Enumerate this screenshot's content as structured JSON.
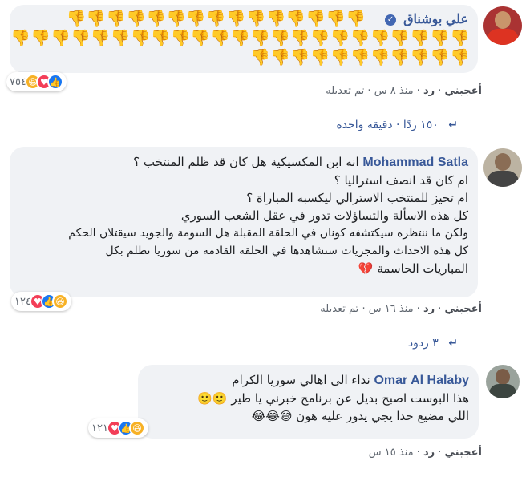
{
  "comments": [
    {
      "author": "علي بوشناق",
      "verified": true,
      "thumbs_rows": [
        "👎👎👎👎👎👎👎👎👎👎👎👎👎👎👎",
        "👎👎👎👎👎👎👎👎👎👎👎👎👎👎👎👎👎👎👎👎👎👎👎",
        "👎👎👎👎👎👎👎👎👎👎👎"
      ],
      "reactions_count": "٧٥٤",
      "like_label": "أعجبني",
      "reply_label": "رد",
      "time": "منذ ٨ س",
      "edited": "تم تعديله",
      "replies_summary": "١٥٠ ردًا · دقيقة واحده"
    },
    {
      "author": "Mohammad Satla",
      "lines": [
        "انه ابن المكسيكية هل كان قد ظلم المنتخب ؟",
        "ام كان قد انصف استراليا ؟",
        "ام تحيز للمنتخب الاسترالي ليكسبه المباراة ؟",
        "كل هذه الاسألة والتساؤلات تدور في عقل الشعب السوري",
        "ولكن ما ننتظره سيكتشفه كونان في الحلقة المقبلة هل السومة والجويد سيقتلان الحكم",
        "كل هذه الاحداث والمجريات سنشاهدها في الحلقة القادمة من سوريا تظلم بكل",
        "المباريات الحاسمة 💔"
      ],
      "reactions_count": "١٢٤",
      "like_label": "أعجبني",
      "reply_label": "رد",
      "time": "منذ ١٦ س",
      "edited": "تم تعديله",
      "replies_summary": "٣ ردود"
    },
    {
      "author": "Omar Al Halaby",
      "lines": [
        "نداء الى اهالي سوريا الكرام",
        "هذا البوست اصبح بديل عن برنامج خبرني يا طير 🙂🙂",
        "اللي مضيع حدا يجي يدور عليه هون 😅😂😂"
      ],
      "reactions_count": "١٢١",
      "like_label": "أعجبني",
      "reply_label": "رد",
      "time": "منذ ١٥ س"
    }
  ],
  "colors": {
    "link": "#385898",
    "bubble": "#f0f2f5",
    "like": "#1877f2",
    "love": "#f33e58",
    "haha": "#f7b125"
  }
}
